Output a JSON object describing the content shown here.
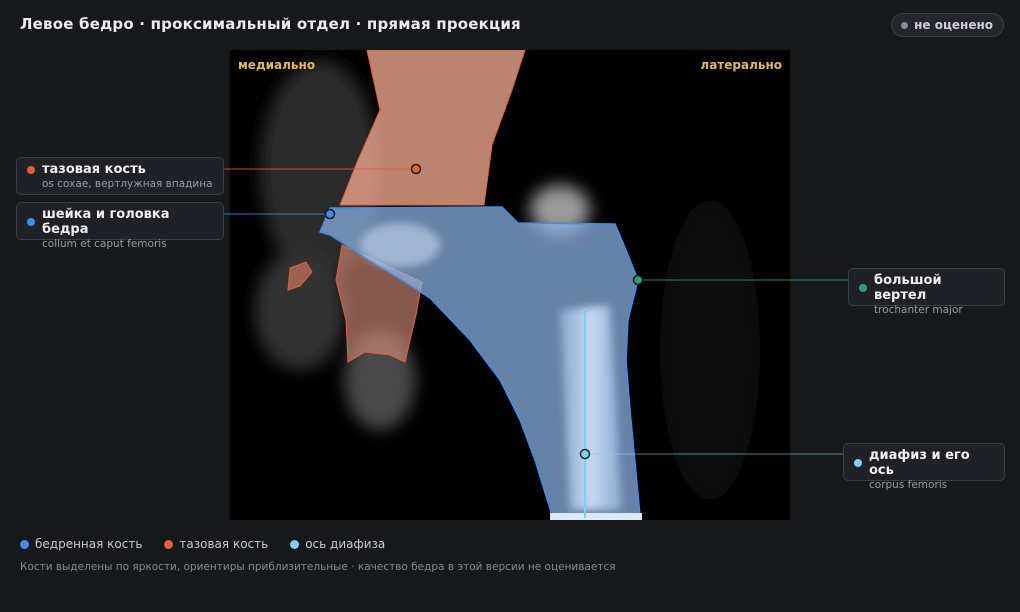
{
  "header": {
    "title": "Левое бедро · проксимальный отдел · прямая проекция",
    "status": "не оценено"
  },
  "viewer": {
    "orientation_left": "медиально",
    "orientation_right": "латерально"
  },
  "callouts": {
    "pelvis": {
      "label": "тазовая кость",
      "sublabel": "os coxae, вертлужная впадина"
    },
    "neck": {
      "label": "шейка и головка бедра",
      "sublabel": "collum et caput femoris"
    },
    "trochanter": {
      "label": "большой вертел",
      "sublabel": "trochanter major"
    },
    "shaft": {
      "label": "диафиз и его ось",
      "sublabel": "corpus femoris"
    }
  },
  "legend": [
    {
      "label": "бедренная кость",
      "color": "#3f8ee8"
    },
    {
      "label": "тазовая кость",
      "color": "#e0603a"
    },
    {
      "label": "ось диафиза",
      "color": "#7fd0f2"
    }
  ],
  "colors": {
    "femur": "#3f8ee8",
    "pelvis": "#e0603a",
    "axis": "#7fd0f2",
    "trochanter": "#2aa37a",
    "orientation": "#e3b85a"
  },
  "footnote": "Кости выделены по яркости, ориентиры приблизительные · качество бедра в этой версии не оценивается"
}
